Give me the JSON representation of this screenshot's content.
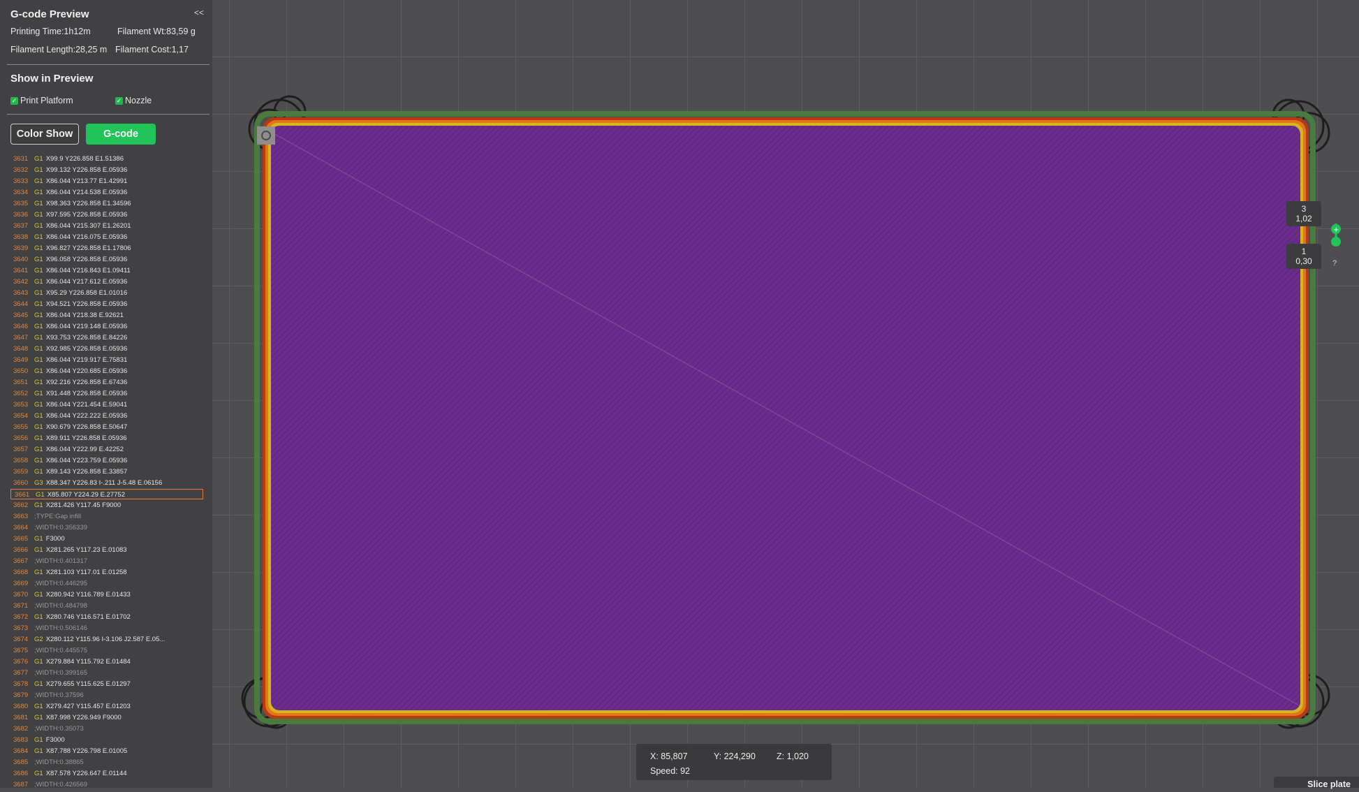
{
  "panel": {
    "title": "G-code Preview",
    "collapse_label": "<<",
    "printing_time": "Printing Time:1h12m",
    "filament_wt": "Filament Wt:83,59 g",
    "filament_length": "Filament Length:28,25 m",
    "filament_cost": "Filament Cost:1,17",
    "show_in_preview": "Show in Preview",
    "print_platform": "Print Platform",
    "nozzle": "Nozzle",
    "print_platform_checked": true,
    "nozzle_checked": true,
    "color_show_label": "Color Show",
    "gcode_label": "G-code",
    "gcode_tab_color": "#20c458"
  },
  "gcode_lines": [
    {
      "n": "3631",
      "cmd": "G1",
      "args": "X99.9 Y226.858 E1.51386"
    },
    {
      "n": "3632",
      "cmd": "G1",
      "args": "X99.132 Y226.858 E.05936"
    },
    {
      "n": "3633",
      "cmd": "G1",
      "args": "X86.044 Y213.77 E1.42991"
    },
    {
      "n": "3634",
      "cmd": "G1",
      "args": "X86.044 Y214.538 E.05936"
    },
    {
      "n": "3635",
      "cmd": "G1",
      "args": "X98.363 Y226.858 E1.34596"
    },
    {
      "n": "3636",
      "cmd": "G1",
      "args": "X97.595 Y226.858 E.05936"
    },
    {
      "n": "3637",
      "cmd": "G1",
      "args": "X86.044 Y215.307 E1.26201"
    },
    {
      "n": "3638",
      "cmd": "G1",
      "args": "X86.044 Y216.075 E.05936"
    },
    {
      "n": "3639",
      "cmd": "G1",
      "args": "X96.827 Y226.858 E1.17806"
    },
    {
      "n": "3640",
      "cmd": "G1",
      "args": "X96.058 Y226.858 E.05936"
    },
    {
      "n": "3641",
      "cmd": "G1",
      "args": "X86.044 Y216.843 E1.09411"
    },
    {
      "n": "3642",
      "cmd": "G1",
      "args": "X86.044 Y217.612 E.05936"
    },
    {
      "n": "3643",
      "cmd": "G1",
      "args": "X95.29 Y226.858 E1.01016"
    },
    {
      "n": "3644",
      "cmd": "G1",
      "args": "X94.521 Y226.858 E.05936"
    },
    {
      "n": "3645",
      "cmd": "G1",
      "args": "X86.044 Y218.38 E.92621"
    },
    {
      "n": "3646",
      "cmd": "G1",
      "args": "X86.044 Y219.148 E.05936"
    },
    {
      "n": "3647",
      "cmd": "G1",
      "args": "X93.753 Y226.858 E.84226"
    },
    {
      "n": "3648",
      "cmd": "G1",
      "args": "X92.985 Y226.858 E.05936"
    },
    {
      "n": "3649",
      "cmd": "G1",
      "args": "X86.044 Y219.917 E.75831"
    },
    {
      "n": "3650",
      "cmd": "G1",
      "args": "X86.044 Y220.685 E.05936"
    },
    {
      "n": "3651",
      "cmd": "G1",
      "args": "X92.216 Y226.858 E.67436"
    },
    {
      "n": "3652",
      "cmd": "G1",
      "args": "X91.448 Y226.858 E.05936"
    },
    {
      "n": "3653",
      "cmd": "G1",
      "args": "X86.044 Y221.454 E.59041"
    },
    {
      "n": "3654",
      "cmd": "G1",
      "args": "X86.044 Y222.222 E.05936"
    },
    {
      "n": "3655",
      "cmd": "G1",
      "args": "X90.679 Y226.858 E.50647"
    },
    {
      "n": "3656",
      "cmd": "G1",
      "args": "X89.911 Y226.858 E.05936"
    },
    {
      "n": "3657",
      "cmd": "G1",
      "args": "X86.044 Y222.99 E.42252"
    },
    {
      "n": "3658",
      "cmd": "G1",
      "args": "X86.044 Y223.759 E.05936"
    },
    {
      "n": "3659",
      "cmd": "G1",
      "args": "X89.143 Y226.858 E.33857"
    },
    {
      "n": "3660",
      "cmd": "G3",
      "args": "X88.347 Y226.83 I-.211 J-5.48 E.06156"
    },
    {
      "n": "3661",
      "cmd": "G1",
      "args": "X85.807 Y224.29 E.27752",
      "highlight": true
    },
    {
      "n": "3662",
      "cmd": "G1",
      "args": "X281.426 Y117.45 F9000"
    },
    {
      "n": "3663",
      "cmd": "",
      "args": ";TYPE:Gap infill"
    },
    {
      "n": "3664",
      "cmd": "",
      "args": ";WIDTH:0.356339"
    },
    {
      "n": "3665",
      "cmd": "G1",
      "args": "F3000"
    },
    {
      "n": "3666",
      "cmd": "G1",
      "args": "X281.265 Y117.23 E.01083"
    },
    {
      "n": "3667",
      "cmd": "",
      "args": ";WIDTH:0.401317"
    },
    {
      "n": "3668",
      "cmd": "G1",
      "args": "X281.103 Y117.01 E.01258"
    },
    {
      "n": "3669",
      "cmd": "",
      "args": ";WIDTH:0.446295"
    },
    {
      "n": "3670",
      "cmd": "G1",
      "args": "X280.942 Y116.789 E.01433"
    },
    {
      "n": "3671",
      "cmd": "",
      "args": ";WIDTH:0.484798"
    },
    {
      "n": "3672",
      "cmd": "G1",
      "args": "X280.746 Y116.571 E.01702"
    },
    {
      "n": "3673",
      "cmd": "",
      "args": ";WIDTH:0.506146"
    },
    {
      "n": "3674",
      "cmd": "G2",
      "args": "X280.112 Y115.96 I-3.106 J2.587 E.05..."
    },
    {
      "n": "3675",
      "cmd": "",
      "args": ";WIDTH:0.445575"
    },
    {
      "n": "3676",
      "cmd": "G1",
      "args": "X279.884 Y115.792 E.01484"
    },
    {
      "n": "3677",
      "cmd": "",
      "args": ";WIDTH:0.399165"
    },
    {
      "n": "3678",
      "cmd": "G1",
      "args": "X279.655 Y115.625 E.01297"
    },
    {
      "n": "3679",
      "cmd": "",
      "args": ";WIDTH:0.37596"
    },
    {
      "n": "3680",
      "cmd": "G1",
      "args": "X279.427 Y115.457 E.01203"
    },
    {
      "n": "3681",
      "cmd": "G1",
      "args": "X87.998 Y226.949 F9000"
    },
    {
      "n": "3682",
      "cmd": "",
      "args": ";WIDTH:0.35073"
    },
    {
      "n": "3683",
      "cmd": "G1",
      "args": "F3000"
    },
    {
      "n": "3684",
      "cmd": "G1",
      "args": "X87.788 Y226.798 E.01005"
    },
    {
      "n": "3685",
      "cmd": "",
      "args": ";WIDTH:0.38865"
    },
    {
      "n": "3686",
      "cmd": "G1",
      "args": "X87.578 Y226.647 E.01144"
    },
    {
      "n": "3687",
      "cmd": "",
      "args": ";WIDTH:0.426569"
    }
  ],
  "coords": {
    "x": "X: 85,807",
    "y": "Y: 224,290",
    "z": "Z: 1,020",
    "speed": "Speed: 92"
  },
  "layer_slider": {
    "top_layer": "3",
    "top_height": "1,02",
    "bottom_layer": "1",
    "bottom_height": "0,30",
    "help": "?"
  },
  "slice_plate_label": "Slice plate",
  "colors": {
    "infill_purple": "#6a2c8c",
    "perimeter_orange": "#e07a1a",
    "accent_green": "#20c458"
  }
}
